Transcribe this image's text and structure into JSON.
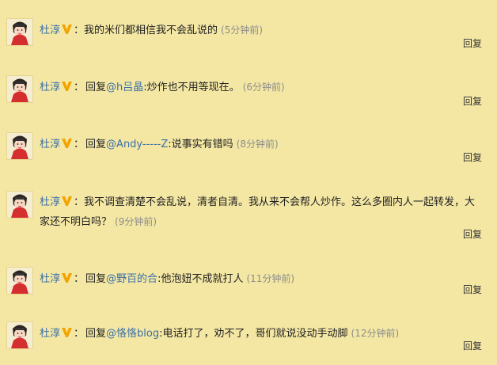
{
  "comments": [
    {
      "author": "杜淳",
      "colon": "：",
      "text": "我的米们都相信我不会乱说的",
      "time": "(5分钟前)",
      "reply": "回复"
    },
    {
      "author": "杜淳",
      "colon": "：",
      "prefix": "回复",
      "mention": "@h吕晶",
      "text": ":炒作也不用等现在。",
      "time": "(6分钟前)",
      "reply": "回复"
    },
    {
      "author": "杜淳",
      "colon": "：",
      "prefix": "回复",
      "mention": "@Andy-----Z",
      "text": ":说事实有错吗",
      "time": "(8分钟前)",
      "reply": "回复"
    },
    {
      "author": "杜淳",
      "colon": "：",
      "text": "我不调查清楚不会乱说，清者自清。我从来不会帮人炒作。这么多圈内人一起转发，大家还不明白吗？",
      "time": "(9分钟前)",
      "reply": "回复"
    },
    {
      "author": "杜淳",
      "colon": "：",
      "prefix": "回复",
      "mention": "@野百的合",
      "text": ":他泡妞不成就打人",
      "time": "(11分钟前)",
      "reply": "回复"
    },
    {
      "author": "杜淳",
      "colon": "：",
      "prefix": "回复",
      "mention": "@恪恪blog",
      "text": ":电话打了，劝不了，哥们就说没动手动脚",
      "time": "(12分钟前)",
      "reply": "回复"
    }
  ],
  "colors": {
    "background": "#f4e7a4",
    "link": "#3a6fa8",
    "time": "#8c8c8c",
    "vip": "#f2a400"
  },
  "icons": {
    "avatar": "cartoon-avatar",
    "verified": "vip-v-icon"
  }
}
